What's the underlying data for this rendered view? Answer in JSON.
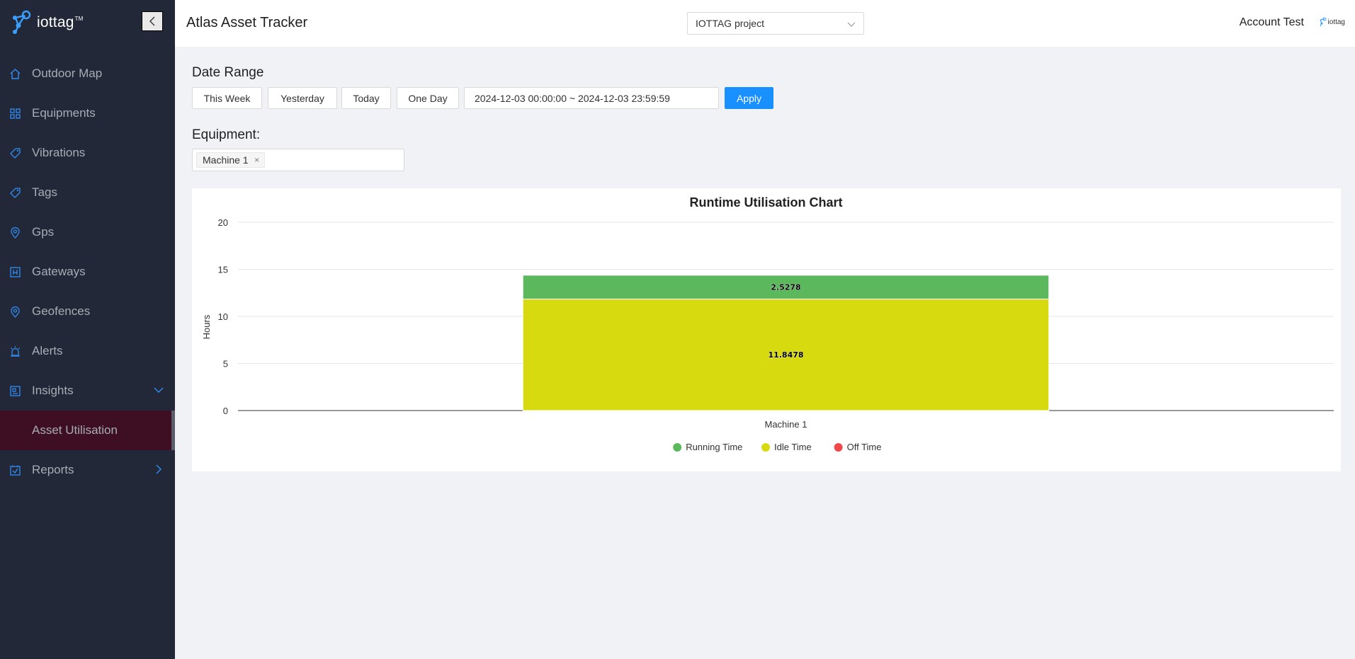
{
  "sidebar": {
    "logo": "iottag",
    "logo_tm": "TM",
    "items": [
      {
        "label": "Outdoor Map",
        "icon": "home-icon"
      },
      {
        "label": "Equipments",
        "icon": "grid-icon"
      },
      {
        "label": "Vibrations",
        "icon": "tag-icon"
      },
      {
        "label": "Tags",
        "icon": "tag-icon"
      },
      {
        "label": "Gps",
        "icon": "location-pin-icon"
      },
      {
        "label": "Gateways",
        "icon": "gateway-icon"
      },
      {
        "label": "Geofences",
        "icon": "location-pin-icon"
      },
      {
        "label": "Alerts",
        "icon": "alarm-icon"
      },
      {
        "label": "Insights",
        "icon": "chart-board-icon"
      },
      {
        "label": "Asset Utilisation",
        "icon": ""
      },
      {
        "label": "Reports",
        "icon": "checkbox-icon"
      }
    ]
  },
  "header": {
    "title": "Atlas Asset Tracker",
    "project": "IOTTAG project",
    "account": "Account Test",
    "mini_logo": "iottag"
  },
  "date_range": {
    "title": "Date Range",
    "buttons": [
      "This Week",
      "Yesterday",
      "Today",
      "One Day"
    ],
    "value": "2024-12-03 00:00:00 ~ 2024-12-03 23:59:59",
    "apply": "Apply"
  },
  "equipment": {
    "title": "Equipment:",
    "selected": "Machine 1",
    "remove": "×"
  },
  "colors": {
    "running": "#5cb85c",
    "idle": "#d6da0f",
    "off": "#f04848",
    "accent": "#1890ff",
    "sidebar_bg": "#232838",
    "active_bg": "#3e0f22"
  },
  "chart_data": {
    "type": "bar",
    "stacked": true,
    "title": "Runtime Utilisation Chart",
    "ylabel": "Hours",
    "xlabel": "",
    "ylim": [
      0,
      20
    ],
    "yticks": [
      0,
      5,
      10,
      15,
      20
    ],
    "categories": [
      "Machine 1"
    ],
    "series": [
      {
        "name": "Off Time",
        "values": [
          0
        ],
        "label": "0",
        "color": "#f04848"
      },
      {
        "name": "Idle Time",
        "values": [
          11.8478
        ],
        "label": "11.8478",
        "color": "#d6da0f"
      },
      {
        "name": "Running Time",
        "values": [
          2.5278
        ],
        "label": "2.5278",
        "color": "#5cb85c"
      }
    ],
    "legend": [
      "Running Time",
      "Idle Time",
      "Off Time"
    ],
    "legend_position": "bottom",
    "grid": true
  }
}
